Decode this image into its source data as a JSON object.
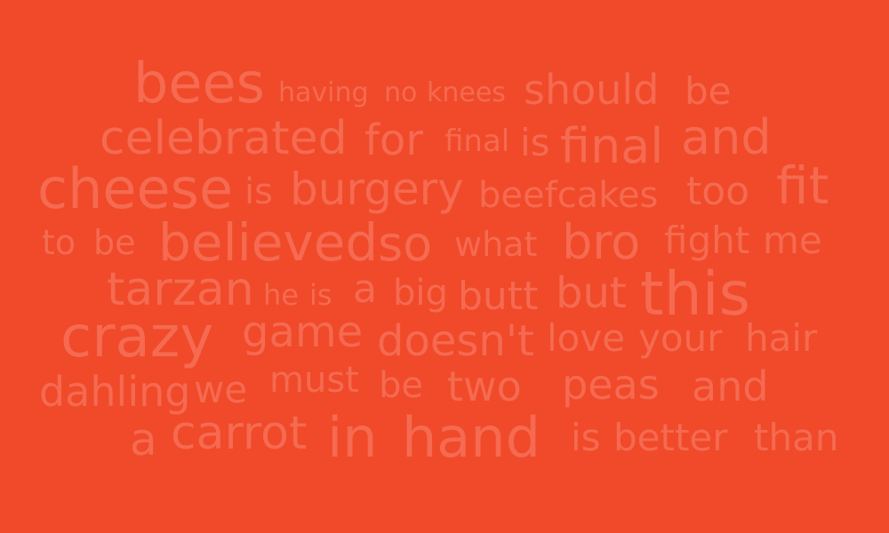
{
  "colors": {
    "background": "#f04a2a",
    "text": "#f56a50"
  },
  "words": [
    "bees",
    "having",
    "no",
    "knees",
    "should",
    "be",
    "celebrated",
    "for",
    "final",
    "is",
    "final",
    "and",
    "cheese",
    "is",
    "burgery",
    "beefcakes",
    "too",
    "fit",
    "to",
    "be",
    "believed",
    "so",
    "what",
    "bro",
    "fight",
    "me",
    "tarzan",
    "he",
    "is",
    "a",
    "big",
    "butt",
    "but",
    "this",
    "crazy",
    "game",
    "doesn't",
    "love",
    "your",
    "hair",
    "dahling",
    "we",
    "must",
    "be",
    "two",
    "peas",
    "and",
    "a",
    "carrot",
    "in",
    "hand",
    "is",
    "better",
    "than"
  ]
}
